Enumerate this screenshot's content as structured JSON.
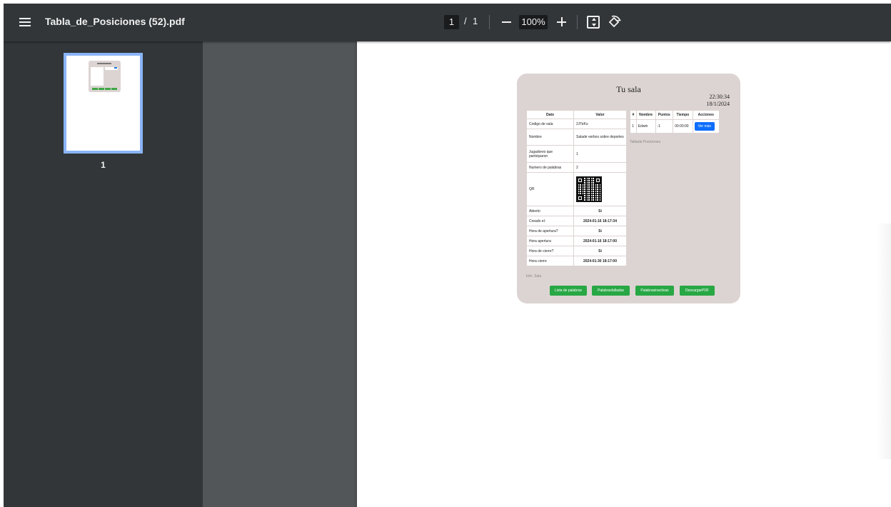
{
  "toolbar": {
    "title": "Tabla_de_Posiciones (52).pdf",
    "page_current": "1",
    "page_separator": "/",
    "page_total": "1",
    "zoom": "100%"
  },
  "sidebar": {
    "thumbnails": [
      {
        "label": "1"
      }
    ]
  },
  "pdf": {
    "title": "Tu sala",
    "time": "22:30:34",
    "date": "18/1/2024",
    "info_table": {
      "headers": [
        "Dato",
        "Valor"
      ],
      "rows": [
        {
          "label": "Codigo de sala",
          "value": "2JTeKo"
        },
        {
          "label": "Nombre",
          "value": "Salade verbos sobre deportes"
        },
        {
          "label": "Jugadores que participaron",
          "value": "1"
        },
        {
          "label": "Numero de palabras",
          "value": "2"
        },
        {
          "label": "QR",
          "value": ""
        },
        {
          "label": "Abierto",
          "value": "Si"
        },
        {
          "label": "Creado el:",
          "value": "2024-01-16  18:17:34"
        },
        {
          "label": "Hora de apertura?",
          "value": "Si"
        },
        {
          "label": "Hora apertura",
          "value": "2024-01-16  18:17:00"
        },
        {
          "label": "Hora de cierre?",
          "value": "Si"
        },
        {
          "label": "Hora cierre",
          "value": "2024-01-30  18:17:00"
        }
      ],
      "caption": "Info. Sala"
    },
    "positions_table": {
      "headers": [
        "#",
        "Nombre",
        "Puntos",
        "Tiempo",
        "Acciones"
      ],
      "rows": [
        {
          "num": "1",
          "name": "Edwin",
          "points": "-1",
          "time": "00:00:00",
          "action": "Ver más"
        }
      ],
      "caption": "Tablade Posiciones"
    },
    "buttons": [
      "Lista de palabras",
      "Palabrasfalladas",
      "Palabrasinactivas",
      "DescargarPDF"
    ]
  },
  "icons": {
    "menu": "menu-icon",
    "zoom_out": "minus-icon",
    "zoom_in": "plus-icon",
    "fit": "fit-to-page-icon",
    "rotate": "rotate-icon"
  },
  "colors": {
    "toolbar_bg": "#323639",
    "viewer_bg": "#525659",
    "thumbnail_border": "#8ab4f8",
    "card_bg": "#dcd4d2",
    "primary_button": "#0d6efd",
    "success_button": "#28a745"
  }
}
